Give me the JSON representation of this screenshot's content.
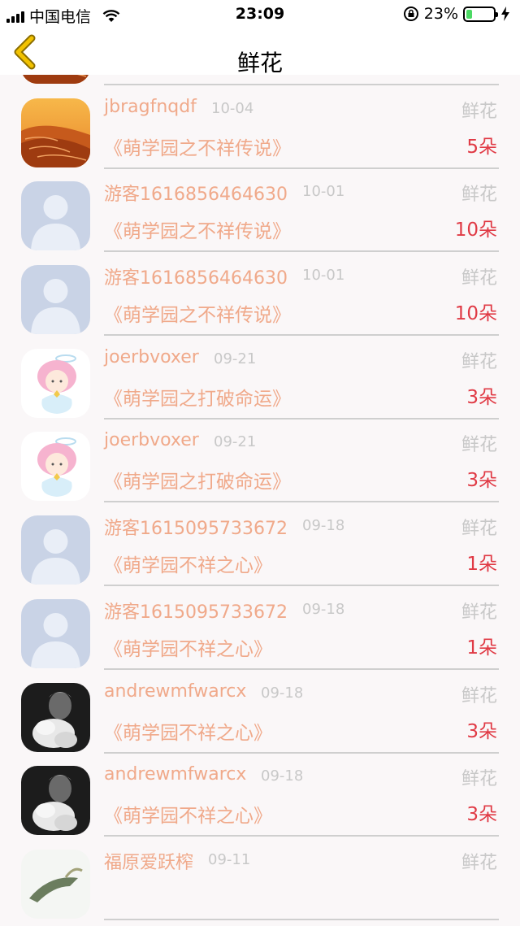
{
  "status_bar": {
    "carrier": "中国电信",
    "time": "23:09",
    "battery": "23%",
    "battery_level": 0.23
  },
  "header": {
    "title": "鲜花"
  },
  "records": [
    {
      "username": "jbragfnqdf",
      "date": "10-04",
      "type": "鲜花",
      "book": "《萌学园之不祥传说》",
      "count": "5朵",
      "avatar": "desert"
    },
    {
      "username": "jbragfnqdf",
      "date": "10-04",
      "type": "鲜花",
      "book": "《萌学园之不祥传说》",
      "count": "5朵",
      "avatar": "desert"
    },
    {
      "username": "游客1616856464630",
      "date": "10-01",
      "type": "鲜花",
      "book": "《萌学园之不祥传说》",
      "count": "10朵",
      "avatar": "default"
    },
    {
      "username": "游客1616856464630",
      "date": "10-01",
      "type": "鲜花",
      "book": "《萌学园之不祥传说》",
      "count": "10朵",
      "avatar": "default"
    },
    {
      "username": "joerbvoxer",
      "date": "09-21",
      "type": "鲜花",
      "book": "《萌学园之打破命运》",
      "count": "3朵",
      "avatar": "angel"
    },
    {
      "username": "joerbvoxer",
      "date": "09-21",
      "type": "鲜花",
      "book": "《萌学园之打破命运》",
      "count": "3朵",
      "avatar": "angel"
    },
    {
      "username": "游客1615095733672",
      "date": "09-18",
      "type": "鲜花",
      "book": "《萌学园不祥之心》",
      "count": "1朵",
      "avatar": "default"
    },
    {
      "username": "游客1615095733672",
      "date": "09-18",
      "type": "鲜花",
      "book": "《萌学园不祥之心》",
      "count": "1朵",
      "avatar": "default"
    },
    {
      "username": "andrewmfwarcx",
      "date": "09-18",
      "type": "鲜花",
      "book": "《萌学园不祥之心》",
      "count": "3朵",
      "avatar": "photo"
    },
    {
      "username": "andrewmfwarcx",
      "date": "09-18",
      "type": "鲜花",
      "book": "《萌学园不祥之心》",
      "count": "3朵",
      "avatar": "photo"
    },
    {
      "username": "福原爱跃榨",
      "date": "09-11",
      "type": "鲜花",
      "book": "",
      "count": "",
      "avatar": "bird"
    }
  ],
  "colors": {
    "accent": "#f0a98a",
    "count": "#e03a45",
    "muted": "#c8c8c8",
    "back_icon": "#f2c200"
  }
}
